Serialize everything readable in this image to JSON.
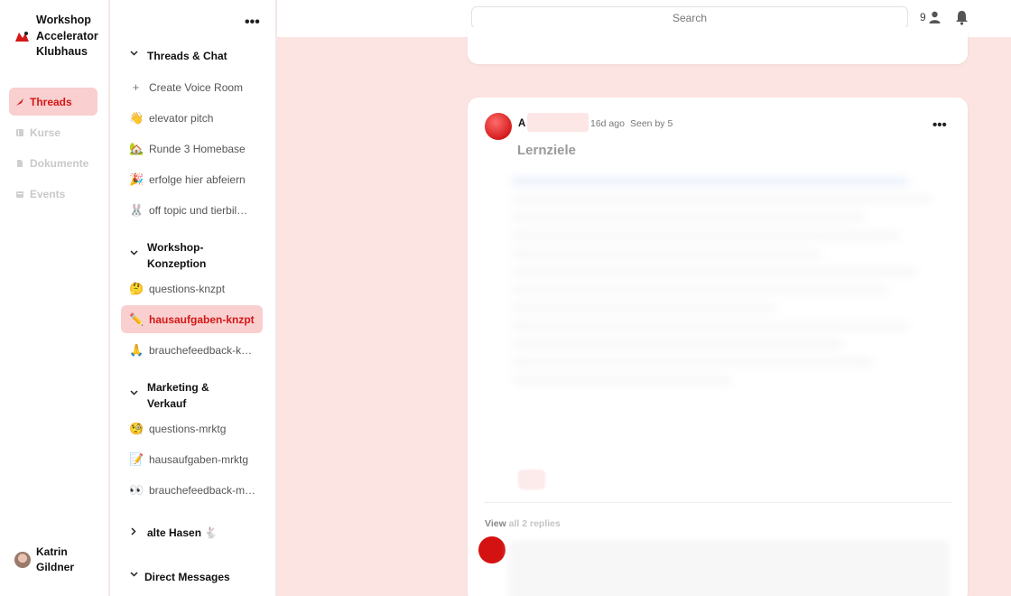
{
  "workspace": {
    "name": "Workshop Accelerator Klubhaus"
  },
  "rail": {
    "items": [
      {
        "label": "Threads",
        "icon": "quill-icon",
        "active": true
      },
      {
        "label": "Kurse",
        "icon": "book-icon",
        "active": false
      },
      {
        "label": "Dokumente",
        "icon": "document-icon",
        "active": false
      },
      {
        "label": "Events",
        "icon": "calendar-icon",
        "active": false
      }
    ],
    "user": {
      "name": "Katrin Gildner"
    }
  },
  "channels": {
    "more_label": "•••",
    "sections": [
      {
        "label": "Threads & Chat",
        "items": [
          {
            "emoji": "+",
            "label": "Create Voice Room"
          },
          {
            "emoji": "👋",
            "label": "elevator pitch"
          },
          {
            "emoji": "🏡",
            "label": "Runde 3 Homebase"
          },
          {
            "emoji": "🎉",
            "label": "erfolge hier abfeiern"
          },
          {
            "emoji": "🐰",
            "label": "off topic und tierbil…"
          }
        ]
      },
      {
        "label": "Workshop-Konzeption",
        "items": [
          {
            "emoji": "🤔",
            "label": "questions-knzpt"
          },
          {
            "emoji": "✏️",
            "label": "hausaufgaben-knzpt",
            "active": true
          },
          {
            "emoji": "🙏",
            "label": "brauchefeedback-k…"
          }
        ]
      },
      {
        "label": "Marketing & Verkauf",
        "items": [
          {
            "emoji": "🧐",
            "label": "questions-mrktg"
          },
          {
            "emoji": "📝",
            "label": "hausaufgaben-mrktg"
          },
          {
            "emoji": "👀",
            "label": "brauchefeedback-m…"
          }
        ]
      },
      {
        "label": "alte Hasen 🐇",
        "collapsed": true
      },
      {
        "label": "Direct Messages"
      }
    ]
  },
  "topbar": {
    "search_placeholder": "Search",
    "online_count": "9"
  },
  "post": {
    "author_initial": "A",
    "time": "16d ago",
    "seen": "Seen by 5",
    "more_label": "•••",
    "title": "Lernziele",
    "view_replies_prefix": "View ",
    "view_replies_rest": "all 2 replies"
  },
  "colors": {
    "accent": "#d41717",
    "accent_bg": "#f9cfcf",
    "page_bg": "#fbe4e2"
  }
}
